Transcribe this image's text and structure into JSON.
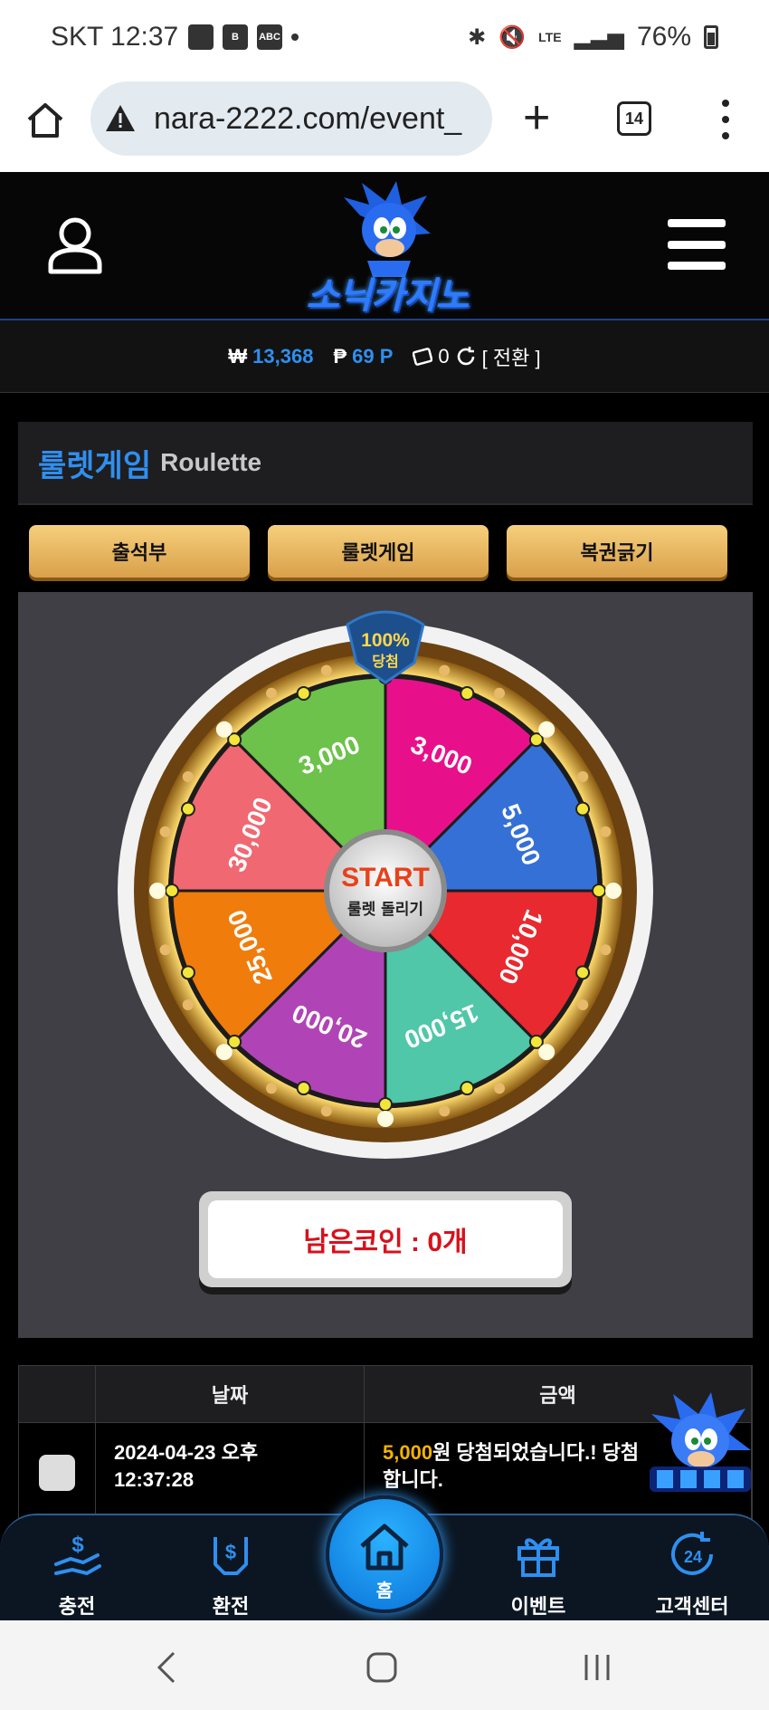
{
  "status_bar": {
    "carrier_time": "SKT 12:37",
    "notif_icons": [
      "photo-icon",
      "b-app-icon",
      "abc-app-icon"
    ],
    "network": "LTE",
    "battery": "76%"
  },
  "browser": {
    "url": "nara-2222.com/event_",
    "tab_count": "14"
  },
  "header": {
    "logo_text": "소닉카지노"
  },
  "balance": {
    "won_symbol": "₩",
    "won_value": "13,368",
    "point_symbol": "₱",
    "point_value": "69 P",
    "coin_value": "0",
    "convert_label": "[ 전환 ]"
  },
  "section": {
    "title_ko": "룰렛게임",
    "title_en": "Roulette"
  },
  "tab_buttons": [
    "출석부",
    "룰렛게임",
    "복권긁기"
  ],
  "roulette": {
    "badge_top": "100%",
    "badge_bottom": "당첨",
    "center_title": "START",
    "center_sub": "룰렛 돌리기",
    "segments": [
      {
        "label": "3,000",
        "color": "#e8108a"
      },
      {
        "label": "5,000",
        "color": "#3470d6"
      },
      {
        "label": "10,000",
        "color": "#e8292f"
      },
      {
        "label": "15,000",
        "color": "#4fc7a8"
      },
      {
        "label": "20,000",
        "color": "#b044b6"
      },
      {
        "label": "25,000",
        "color": "#f07c0c"
      },
      {
        "label": "30,000",
        "color": "#f06872"
      },
      {
        "label": "3,000",
        "color": "#6cc24a"
      }
    ],
    "remaining_coins": "남은코인 : 0개"
  },
  "history": {
    "headers": [
      "",
      "날짜",
      "금액"
    ],
    "rows": [
      {
        "date_line1": "2024-04-23 오후",
        "date_line2": "12:37:28",
        "amount": "5,000",
        "message_rest": "원 당첨되었습니다.! 당첨",
        "message_line2": "합니다."
      }
    ]
  },
  "bottom_nav": {
    "items": [
      "충전",
      "환전",
      "홈",
      "이벤트",
      "고객센터"
    ]
  },
  "colors": {
    "accent_blue": "#2f8ff0",
    "gold_button": "#f6cf7c",
    "coin_red": "#d6121c",
    "win_amount": "#f5b300"
  }
}
